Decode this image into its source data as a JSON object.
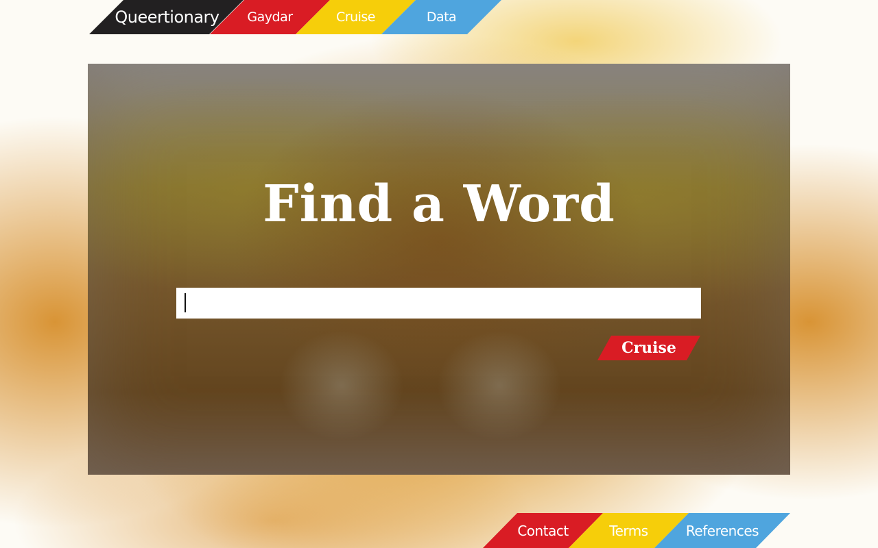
{
  "nav": {
    "brand": "Queertionary",
    "items": [
      {
        "label": "Gaydar"
      },
      {
        "label": "Cruise"
      },
      {
        "label": "Data"
      }
    ]
  },
  "hero": {
    "title": "Find a Word",
    "search": {
      "value": "",
      "placeholder": ""
    },
    "button_label": "Cruise"
  },
  "footer": {
    "items": [
      {
        "label": "Contact"
      },
      {
        "label": "Terms"
      },
      {
        "label": "References"
      }
    ]
  },
  "colors": {
    "brand_dark": "#222021",
    "red": "#d91c24",
    "yellow": "#f6ce0a",
    "blue": "#4fa5de"
  }
}
